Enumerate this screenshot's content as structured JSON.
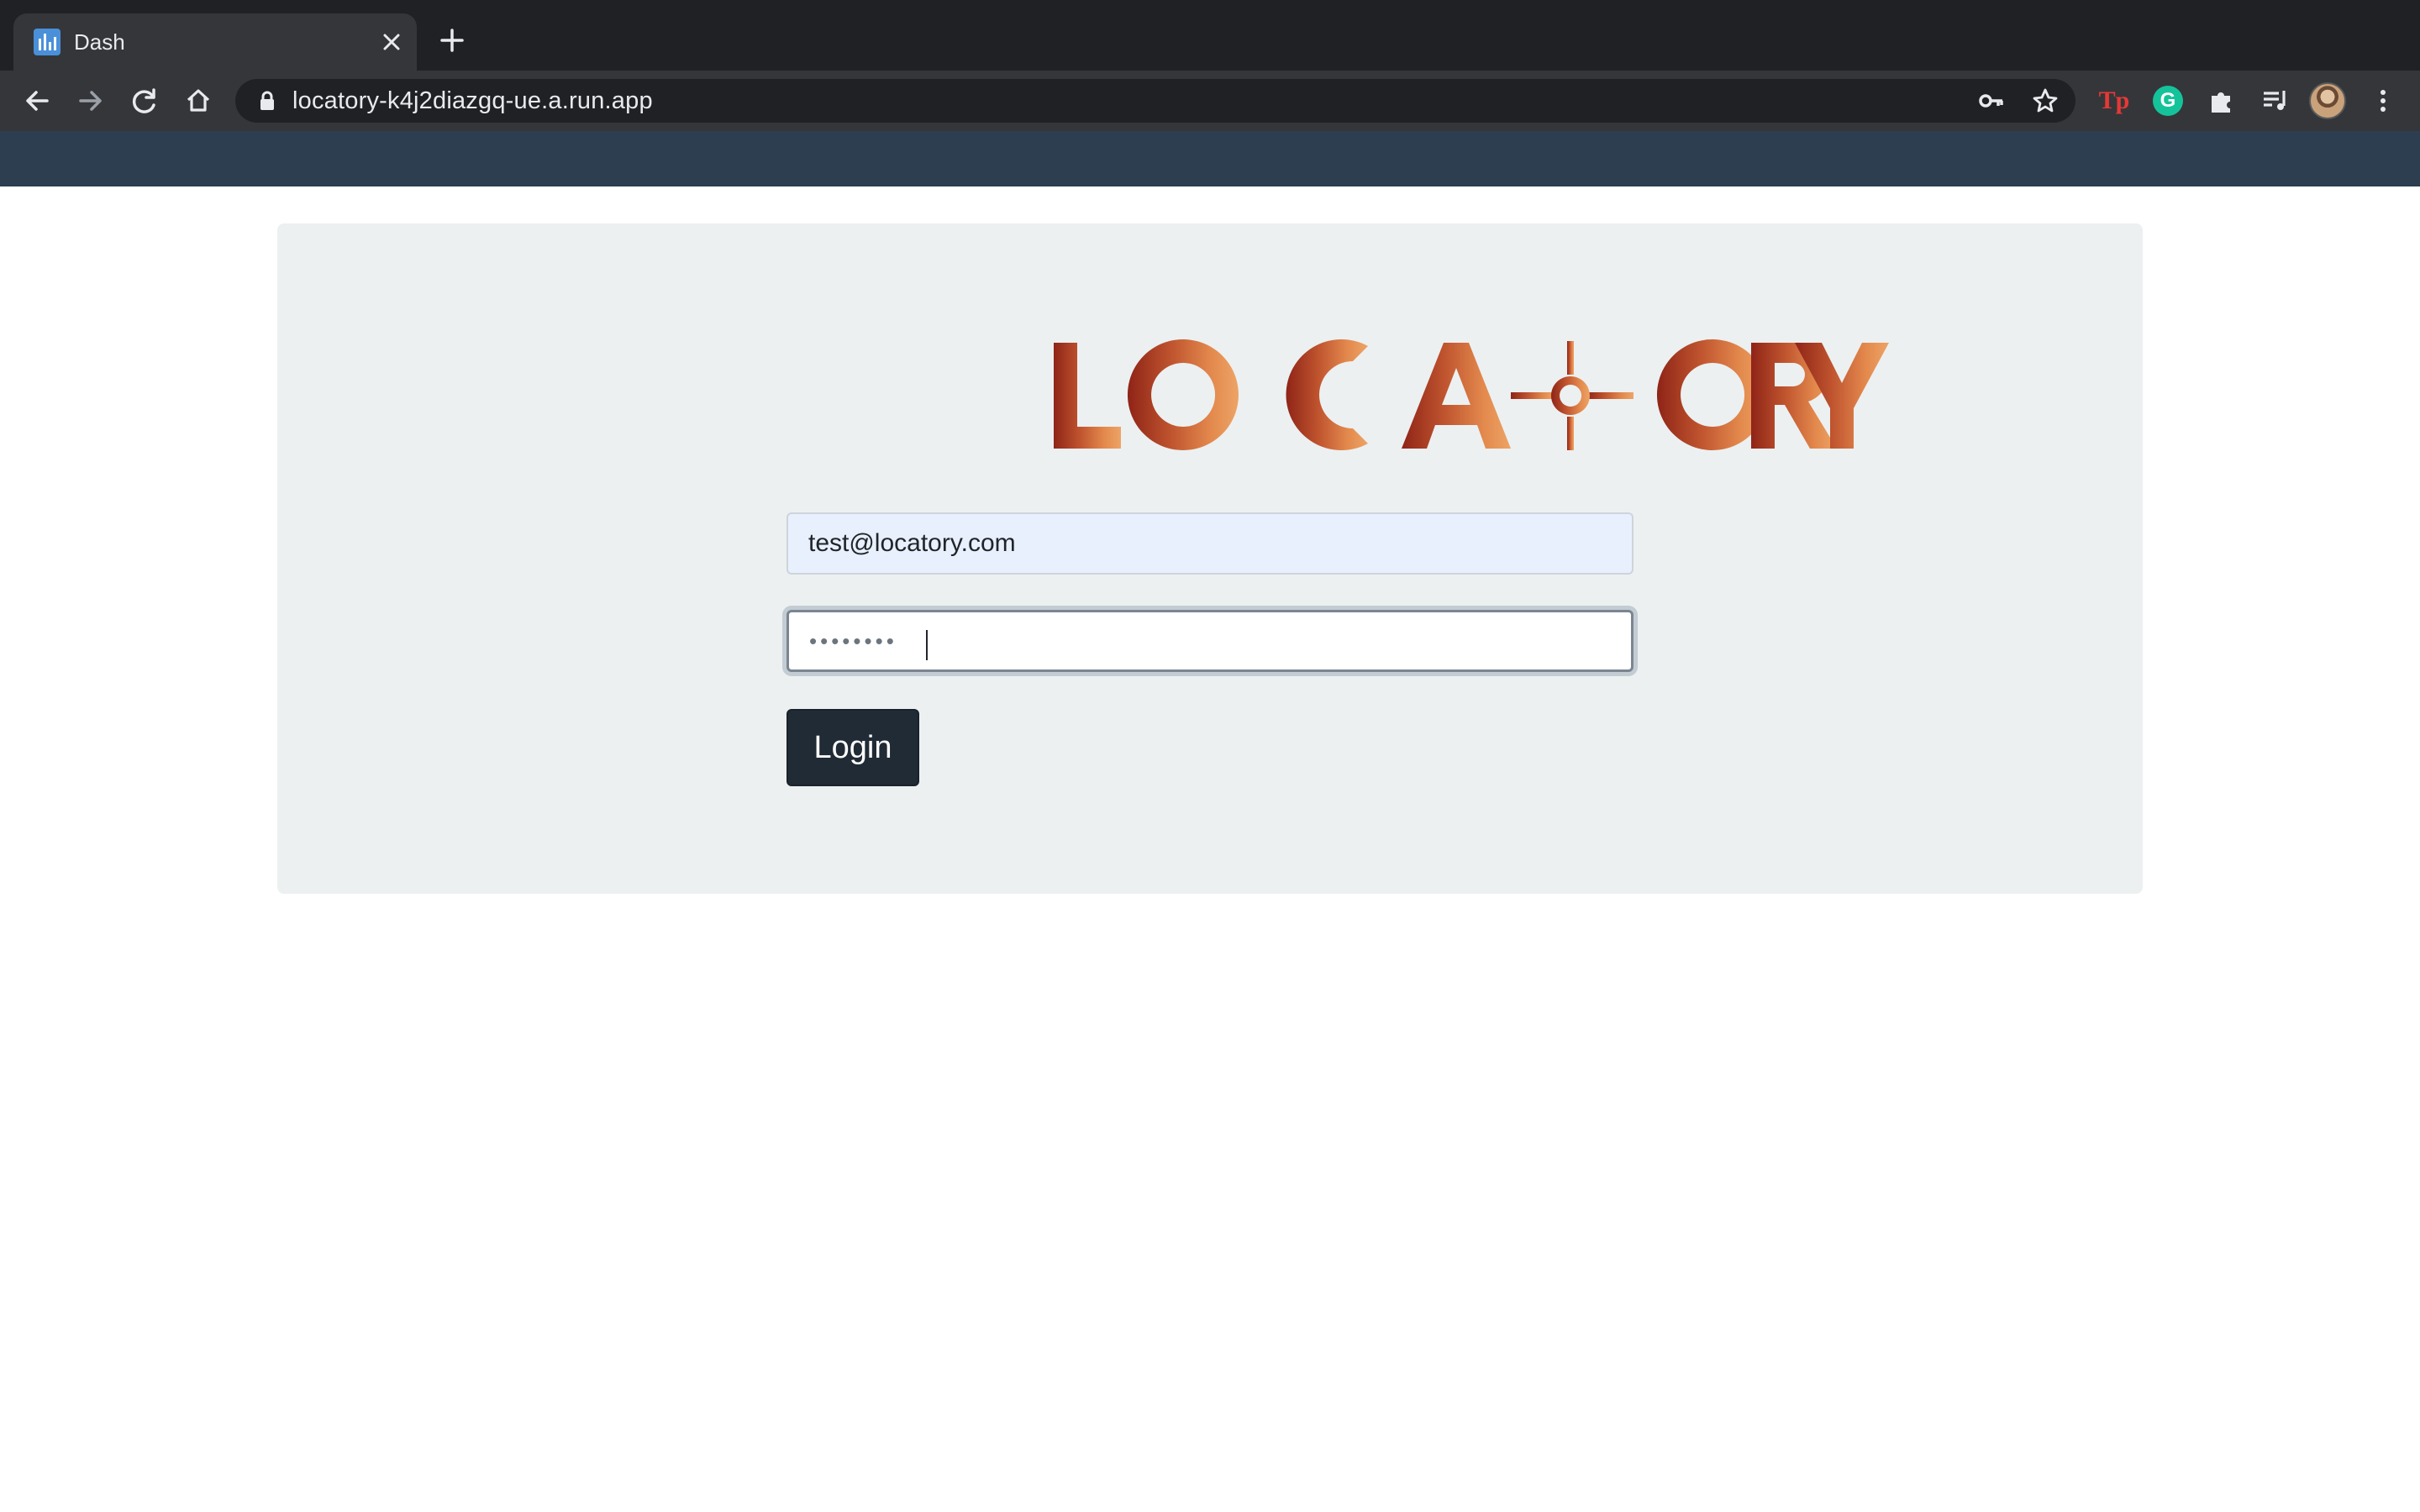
{
  "browser": {
    "tab_title": "Dash",
    "url": "locatory-k4j2diazgq-ue.a.run.app",
    "icons": {
      "tab": [
        "dash-favicon",
        "close-icon",
        "new-tab-icon"
      ],
      "nav": [
        "back-arrow-icon",
        "forward-arrow-icon",
        "reload-icon",
        "home-icon"
      ],
      "omnibox": [
        "lock-icon",
        "key-icon",
        "star-icon"
      ],
      "extensions": [
        "tp-extension-icon",
        "grammarly-icon",
        "puzzle-icon",
        "media-control-icon",
        "profile-avatar",
        "kebab-menu-icon"
      ]
    },
    "extension_labels": {
      "tp": "Tp",
      "grammarly": "G"
    }
  },
  "colors": {
    "chrome_dark": "#202124",
    "chrome_toolbar": "#35363a",
    "app_bar": "#2c3e50",
    "card": "#ecf0f1",
    "autofill": "#e8f0fe",
    "button": "#212b35",
    "logo_gradient": [
      "#8f2417",
      "#c0552f",
      "#e3894d",
      "#eda466"
    ]
  },
  "login": {
    "logo_text": "LOCATORY",
    "email_value": "test@locatory.com",
    "password_value": "••••••••",
    "login_label": "Login"
  }
}
